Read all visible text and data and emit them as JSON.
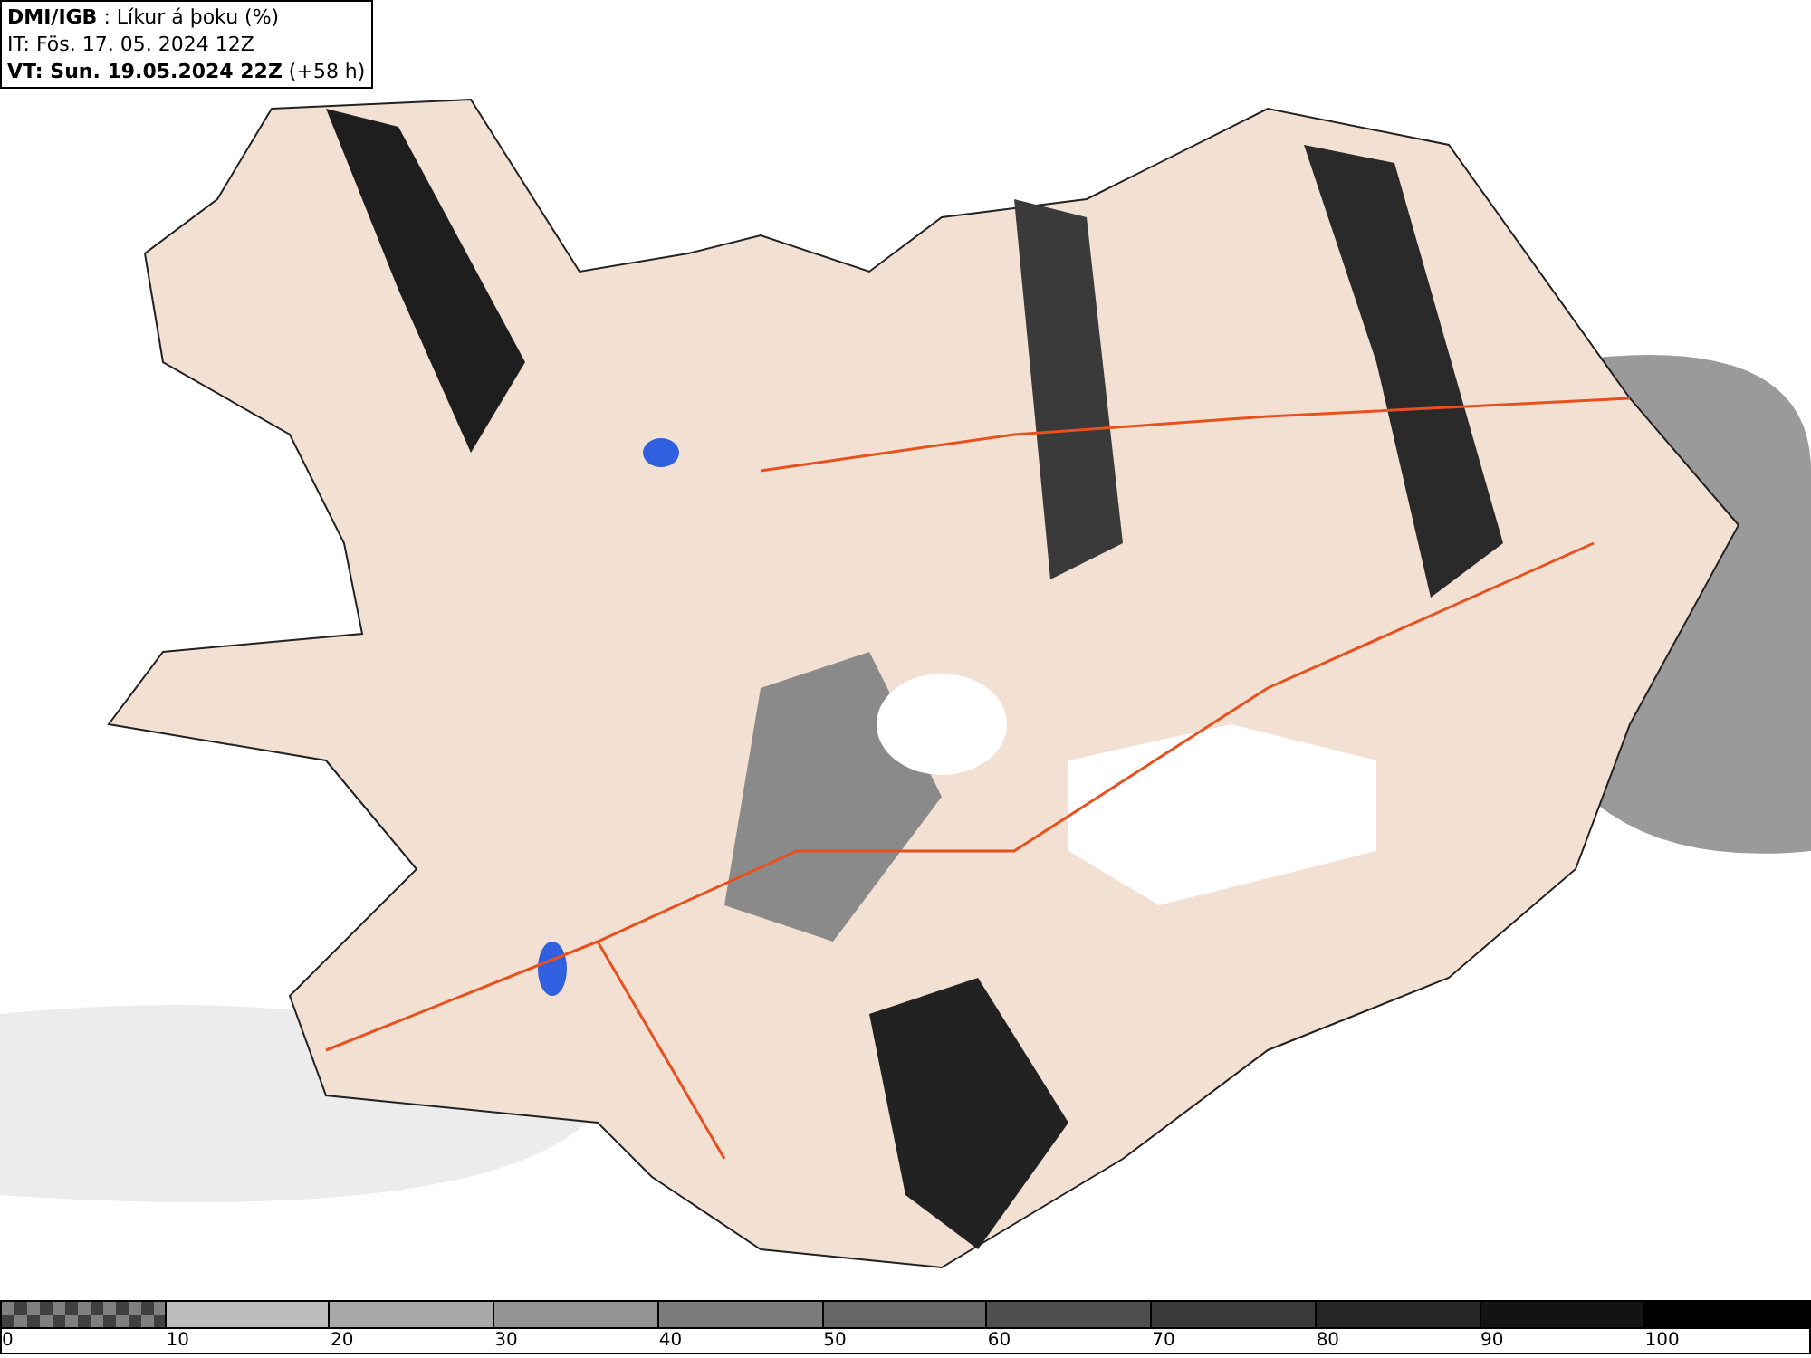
{
  "header": {
    "lines": [
      "**DMI/IGB** : Líkur á þoku (%)",
      "IT: Fös. 17. 05. 2024 12Z",
      "**VT: Sun. 19.05.2024 22Z** (+58 h)"
    ]
  },
  "legend": [
    {
      "kind": "checker",
      "label": "0"
    },
    {
      "kind": "solid",
      "label": "10",
      "color": "#bdbdbd"
    },
    {
      "kind": "solid",
      "label": "20",
      "color": "#a9a9a9"
    },
    {
      "kind": "solid",
      "label": "30",
      "color": "#939393"
    },
    {
      "kind": "solid",
      "label": "40",
      "color": "#7c7c7c"
    },
    {
      "kind": "solid",
      "label": "50",
      "color": "#666666"
    },
    {
      "kind": "solid",
      "label": "60",
      "color": "#4f4f4f"
    },
    {
      "kind": "solid",
      "label": "70",
      "color": "#3a3a3a"
    },
    {
      "kind": "solid",
      "label": "80",
      "color": "#262626"
    },
    {
      "kind": "solid",
      "label": "90",
      "color": "#131313"
    },
    {
      "kind": "solid",
      "label": "100",
      "color": "#000000"
    }
  ]
}
